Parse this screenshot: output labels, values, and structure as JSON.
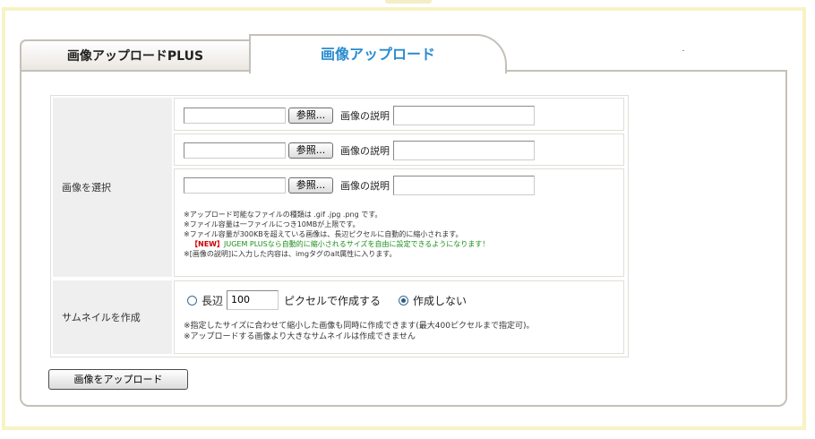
{
  "tabs": {
    "inactive_label": "画像アップロードPLUS",
    "active_label": "画像アップロード"
  },
  "form": {
    "select_label": "画像を選択",
    "thumb_label": "サムネイルを作成",
    "browse_label": "参照...",
    "desc_label": "画像の説明",
    "notes": [
      "※アップロード可能なファイルの種類は .gif .jpg .png です。",
      "※ファイル容量は一ファイルにつき10MBが上限です。",
      "※ファイル容量が300KBを超えている画像は、長辺ピクセルに自動的に縮小されます。"
    ],
    "new_tag": "【NEW】",
    "new_note": "JUGEM PLUSなら自動的に縮小されるサイズを自由に設定できるようになります！",
    "note_last": "※[画像の説明]に入力した内容は、imgタグのalt属性に入ります。",
    "thumb": {
      "long_side_label": "長辺",
      "pixel_value": "100",
      "create_label": "ピクセルで作成する",
      "no_create_label": "作成しない",
      "selected": "no_create"
    },
    "thumb_notes": [
      "※指定したサイズに合わせて縮小した画像も同時に作成できます(最大400ピクセルまで指定可)。",
      "※アップロードする画像より大きなサムネイルは作成できません"
    ]
  },
  "submit_label": "画像をアップロード",
  "colors": {
    "active_tab_text": "#2a8ccf",
    "frame_yellow": "#f8f3c5",
    "label_bg": "#efefef",
    "new_tag": "#cc0000",
    "new_note": "#1a8f1a"
  }
}
